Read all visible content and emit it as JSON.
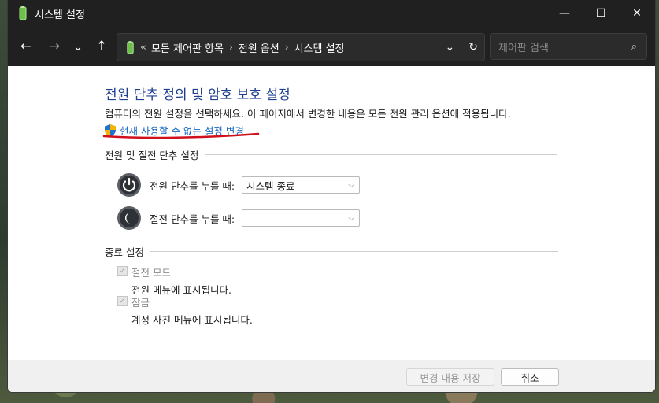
{
  "window": {
    "title": "시스템 설정",
    "controls": {
      "minimize": "—",
      "maximize": "☐",
      "close": "✕"
    }
  },
  "nav": {
    "back": "←",
    "forward": "→",
    "recent": "⌄",
    "up": "↑",
    "breadcrumb_lead": "«",
    "breadcrumbs": [
      "모든 제어판 항목",
      "전원 옵션",
      "시스템 설정"
    ],
    "separator": "›",
    "dropdown": "⌄",
    "refresh": "↻",
    "search_placeholder": "제어판 검색",
    "search_icon": "⌕"
  },
  "content": {
    "heading": "전원 단추 정의 및 암호 보호 설정",
    "description": "컴퓨터의 전원 설정을 선택하세요. 이 페이지에서 변경한 내용은 모든 전원 관리 옵션에 적용됩니다.",
    "change_link": "현재 사용할 수 없는 설정 변경",
    "power_group": {
      "title": "전원 및 절전 단추 설정",
      "rows": [
        {
          "label": "전원 단추를 누를 때:",
          "value": "시스템 종료",
          "icon": "power-button-icon"
        },
        {
          "label": "절전 단추를 누를 때:",
          "value": "",
          "icon": "sleep-button-icon"
        }
      ]
    },
    "shutdown_group": {
      "title": "종료 설정",
      "items": [
        {
          "title": "절전 모드",
          "subtitle": "전원 메뉴에 표시됩니다.",
          "checked": true
        },
        {
          "title": "잠금",
          "subtitle": "계정 사진 메뉴에 표시됩니다.",
          "checked": true
        }
      ]
    }
  },
  "footer": {
    "save": "변경 내용 저장",
    "cancel": "취소"
  },
  "colors": {
    "heading": "#1e3f8f",
    "link": "#1565c0",
    "annotation": "#d0101c",
    "titlebar": "#202020"
  }
}
